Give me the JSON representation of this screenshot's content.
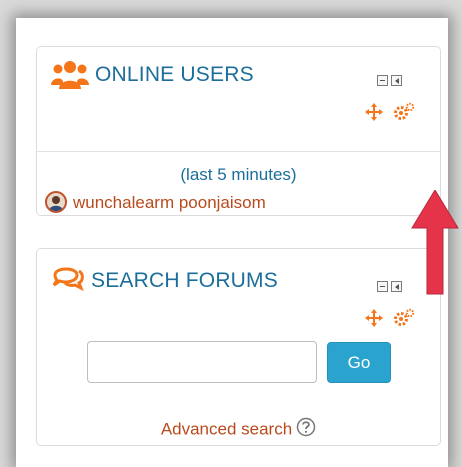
{
  "online_users_block": {
    "title": "ONLINE USERS",
    "subtitle": "(last 5 minutes)",
    "users": [
      {
        "name": "wunchalearm poonjaisom"
      }
    ]
  },
  "search_forums_block": {
    "title": "SEARCH FORUMS",
    "search_input_value": "",
    "go_label": "Go",
    "advanced_link": "Advanced search"
  },
  "icons": {
    "users_icon": "users-icon",
    "forum_icon": "forum-icon",
    "move_icon": "move-icon",
    "settings_icon": "cog-icon",
    "help_icon": "help-icon"
  },
  "colors": {
    "title_blue": "#1b6e9a",
    "link_orange": "#b84a1e",
    "accent_orange": "#f4751a",
    "go_button": "#2aa3cf",
    "arrow_red": "#e53349"
  }
}
